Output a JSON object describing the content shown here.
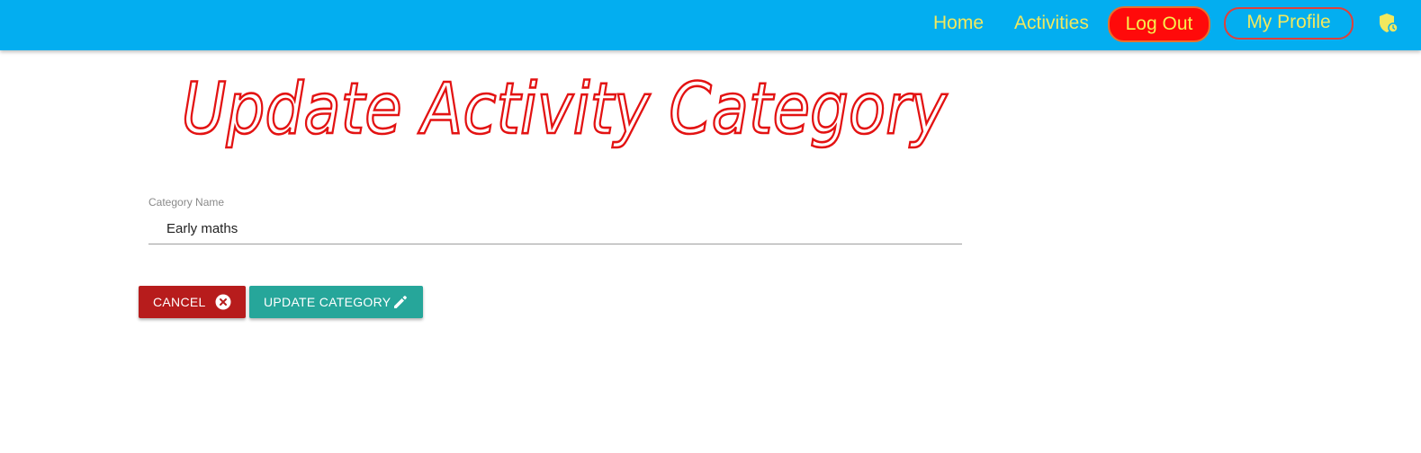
{
  "nav": {
    "home": "Home",
    "activities": "Activities",
    "logout": "Log Out",
    "profile": "My Profile",
    "shield_icon": "shield-icon"
  },
  "page": {
    "title": "Update Activity Category",
    "title_color": "#e31212"
  },
  "form": {
    "category_label": "Category Name",
    "category_value": "Early maths"
  },
  "buttons": {
    "cancel": "CANCEL",
    "cancel_icon": "close-circle-icon",
    "update": "UPDATE CATEGORY",
    "update_icon": "pencil-icon"
  },
  "colors": {
    "navbar": "#03aef0",
    "nav_text": "#f2e85e",
    "logout_bg": "#ff0a0a",
    "cancel_bg": "#b71c1c",
    "update_bg": "#26a69a"
  }
}
